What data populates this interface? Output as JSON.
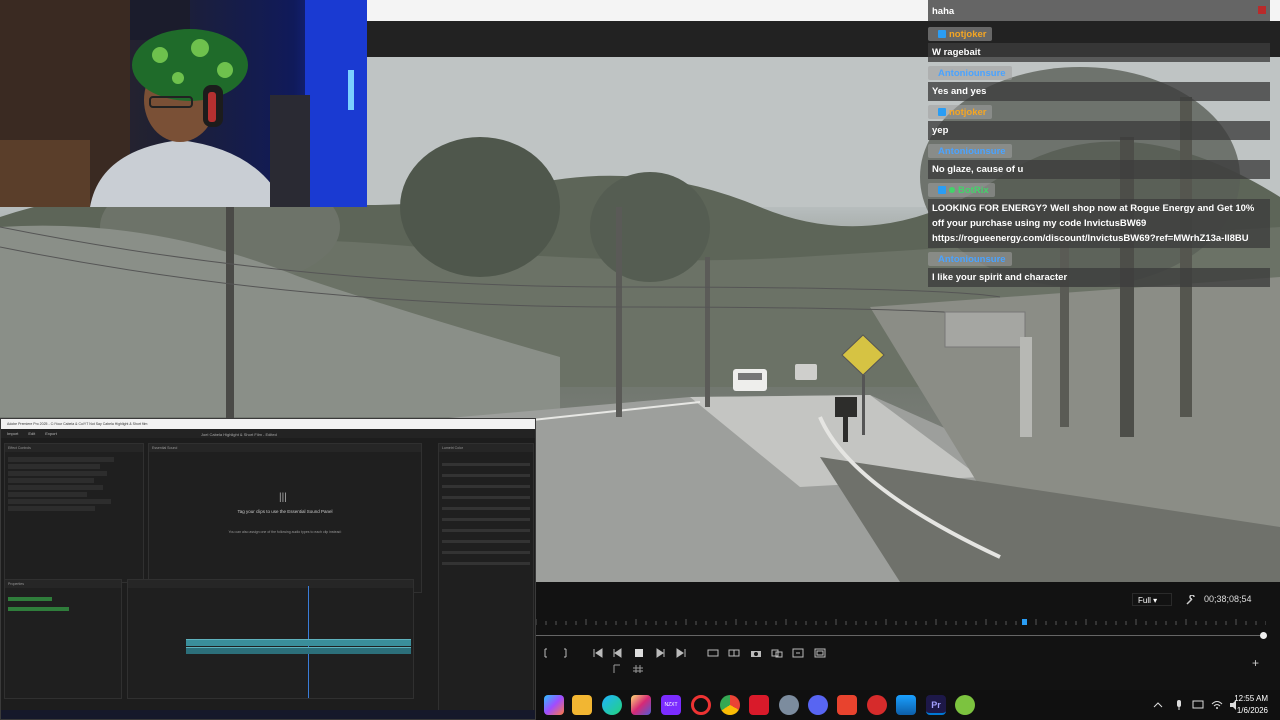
{
  "chat": {
    "messages": [
      {
        "user": "",
        "text": "haha"
      },
      {
        "user": "notjoker",
        "text": "W ragebait",
        "color": "#f5a623"
      },
      {
        "user": "Antoniounsure",
        "text": "Yes and yes",
        "color": "#4aa3ff"
      },
      {
        "user": "notjoker",
        "text": "yep",
        "color": "#f5a623"
      },
      {
        "user": "Antoniounsure",
        "text": "No glaze, cause of u",
        "color": "#4aa3ff"
      },
      {
        "user": "BotRix",
        "text": "LOOKING FOR ENERGY? Well shop now at Rogue Energy and Get 10% off your purchase using my code InvictusBW69 https://rogueenergy.com/discount/InvictusBW69?ref=MWrhZ13a-Il8BU",
        "color": "#43d36a"
      },
      {
        "user": "Antoniounsure",
        "text": "I like your spirit and character",
        "color": "#4aa3ff"
      }
    ]
  },
  "premiere": {
    "window_title": "Adobe Premiere Pro 2025 - C:\\Your Cabela & Co\\YT Not Say Cabela Highlight & Short film",
    "menu": [
      "Import",
      "Edit",
      "Export"
    ],
    "center_title": "Joel Cabela Highlight & Short Film - Edited",
    "panel_tabs": [
      "Effect Controls",
      "Essential Sound",
      "Lumetri Color",
      "Properties"
    ],
    "essential_sound_prompt": "Tag your clips to use the Essential Sound Panel",
    "essential_sound_sub": "You can also assign one of the following audio types to each clip instead:",
    "timeline_timecode": "00;38;08;54"
  },
  "player": {
    "resolution": "Full",
    "timecode": "00;38;08;54",
    "playhead_fraction": 0.668
  },
  "taskbar": {
    "time": "12:55 AM",
    "date": "1/6/2026",
    "apps": [
      "copilot",
      "file-explorer",
      "edge",
      "instagram",
      "nzxt",
      "opera",
      "chrome",
      "voice-app",
      "settings",
      "discord",
      "app",
      "app",
      "photos",
      "premiere",
      "xbox"
    ],
    "accent": "#0078d4"
  }
}
